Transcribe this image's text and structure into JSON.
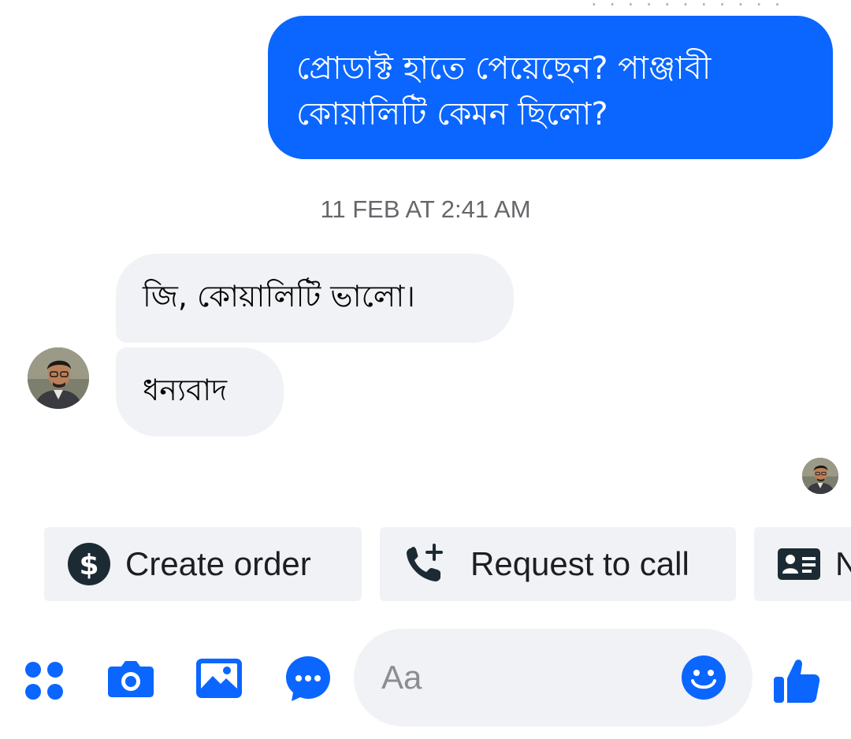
{
  "colors": {
    "accent": "#0a66ff",
    "incoming_bubble": "#f0f2f5",
    "timestamp": "#65676b"
  },
  "thread": {
    "top_cutoff_text": "· · · · · · · · · · ·",
    "outgoing_message": "প্রোডাক্ট হাতে পেয়েছেন?  পাঞ্জাবী কোয়ালিটি কেমন ছিলো?",
    "timestamp": "11 FEB AT 2:41 AM",
    "incoming_messages": [
      {
        "text": "জি, কোয়ালিটি ভালো।"
      },
      {
        "text": "ধন্যবাদ"
      }
    ],
    "sender_avatar": "profile-photo",
    "seen_avatar": "seen-receipt-avatar"
  },
  "quick_actions": [
    {
      "label": "Create order",
      "icon": "dollar-circle-icon"
    },
    {
      "label": "Request to call",
      "icon": "phone-plus-icon"
    },
    {
      "label": "N",
      "icon": "contact-card-icon"
    }
  ],
  "composer": {
    "placeholder": "Aa",
    "tools": [
      "apps-grid-icon",
      "camera-icon",
      "gallery-icon",
      "chat-bubble-icon"
    ],
    "emoji_icon": "smiley-icon",
    "send_icon": "thumbs-up-icon"
  }
}
